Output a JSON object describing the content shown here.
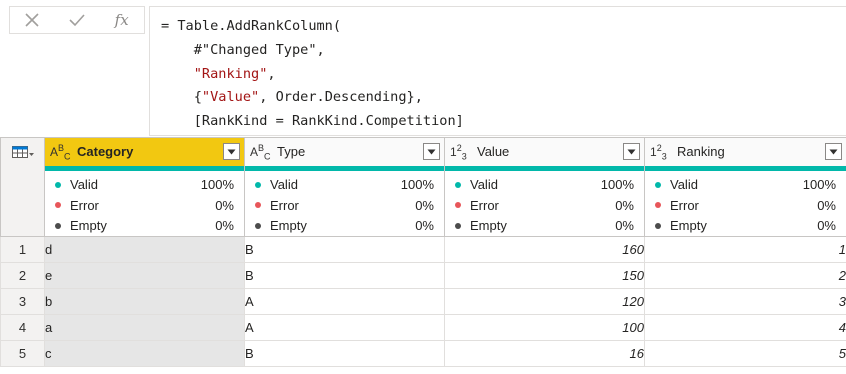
{
  "formula_bar": {
    "cancel_icon": "close-icon",
    "commit_icon": "check-icon",
    "fx_label": "fx",
    "formula_lines": [
      {
        "parts": [
          {
            "t": "= Table.AddRankColumn(",
            "s": false
          }
        ]
      },
      {
        "parts": [
          {
            "t": "    #\"Changed Type\",",
            "s": false
          }
        ]
      },
      {
        "parts": [
          {
            "t": "    ",
            "s": false
          },
          {
            "t": "\"Ranking\"",
            "s": true
          },
          {
            "t": ",",
            "s": false
          }
        ]
      },
      {
        "parts": [
          {
            "t": "    {",
            "s": false
          },
          {
            "t": "\"Value\"",
            "s": true
          },
          {
            "t": ", Order.Descending},",
            "s": false
          }
        ]
      },
      {
        "parts": [
          {
            "t": "    [RankKind = RankKind.Competition]",
            "s": false
          }
        ]
      },
      {
        "parts": [
          {
            "t": ")",
            "s": false
          }
        ]
      }
    ]
  },
  "colors": {
    "selected_header": "#f2c811",
    "quality_bar": "#01b8aa",
    "valid": "#01b8aa",
    "error": "#e8565a",
    "empty": "#4c4c4c",
    "string": "#a31515"
  },
  "columns": [
    {
      "type_icon": "text-type-icon",
      "name": "Category",
      "selected": true,
      "quality": {
        "valid": "100%",
        "error": "0%",
        "empty": "0%"
      }
    },
    {
      "type_icon": "text-type-icon",
      "name": "Type",
      "selected": false,
      "quality": {
        "valid": "100%",
        "error": "0%",
        "empty": "0%"
      }
    },
    {
      "type_icon": "whole-number-type-icon",
      "name": "Value",
      "selected": false,
      "quality": {
        "valid": "100%",
        "error": "0%",
        "empty": "0%"
      }
    },
    {
      "type_icon": "whole-number-type-icon",
      "name": "Ranking",
      "selected": false,
      "quality": {
        "valid": "100%",
        "error": "0%",
        "empty": "0%"
      }
    }
  ],
  "quality_labels": {
    "valid": "Valid",
    "error": "Error",
    "empty": "Empty"
  },
  "rows": [
    {
      "n": "1",
      "cells": [
        "d",
        "B",
        "160",
        "1"
      ]
    },
    {
      "n": "2",
      "cells": [
        "e",
        "B",
        "150",
        "2"
      ]
    },
    {
      "n": "3",
      "cells": [
        "b",
        "A",
        "120",
        "3"
      ]
    },
    {
      "n": "4",
      "cells": [
        "a",
        "A",
        "100",
        "4"
      ]
    },
    {
      "n": "5",
      "cells": [
        "c",
        "B",
        "16",
        "5"
      ]
    }
  ]
}
